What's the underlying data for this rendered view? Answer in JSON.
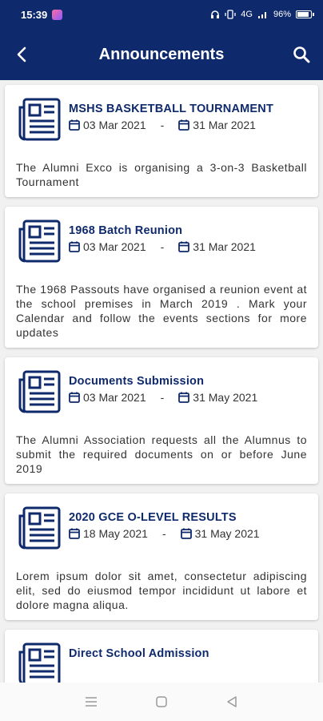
{
  "status_bar": {
    "time": "15:39",
    "network": "4G",
    "battery": "96%",
    "battery_level": 0.96
  },
  "app_bar": {
    "title": "Announcements",
    "back_icon": "back-arrow-icon",
    "search_icon": "search-icon"
  },
  "announcements": [
    {
      "title": "MSHS BASKETBALL TOURNAMENT",
      "start_date": "03 Mar 2021",
      "end_date": "31 Mar 2021",
      "separator": "-",
      "description": "The Alumni Exco is organising a 3-on-3 Basketball Tournament"
    },
    {
      "title": "1968 Batch Reunion",
      "start_date": "03 Mar 2021",
      "end_date": "31 Mar 2021",
      "separator": "-",
      "description": "The 1968 Passouts have organised a reunion event at the school premises in March 2019 . Mark your Calendar and follow the events sections for more updates"
    },
    {
      "title": "Documents Submission",
      "start_date": "03 Mar 2021",
      "end_date": "31 May 2021",
      "separator": "-",
      "description": "The Alumni Association requests all the Alumnus to submit the required documents on or before June 2019"
    },
    {
      "title": "2020 GCE O-LEVEL RESULTS",
      "start_date": "18 May 2021",
      "end_date": "31 May 2021",
      "separator": "-",
      "description": "Lorem ipsum dolor sit amet, consectetur adipiscing elit, sed do eiusmod tempor incididunt ut labore et dolore magna aliqua."
    },
    {
      "title": "Direct School Admission",
      "start_date": "",
      "end_date": "",
      "separator": "",
      "description": ""
    }
  ],
  "nav_bar": {
    "icons": [
      "menu-icon",
      "home-icon",
      "back-icon"
    ]
  },
  "colors": {
    "primary": "#0f2a6c",
    "background": "#f1f1f1",
    "card": "#ffffff"
  }
}
